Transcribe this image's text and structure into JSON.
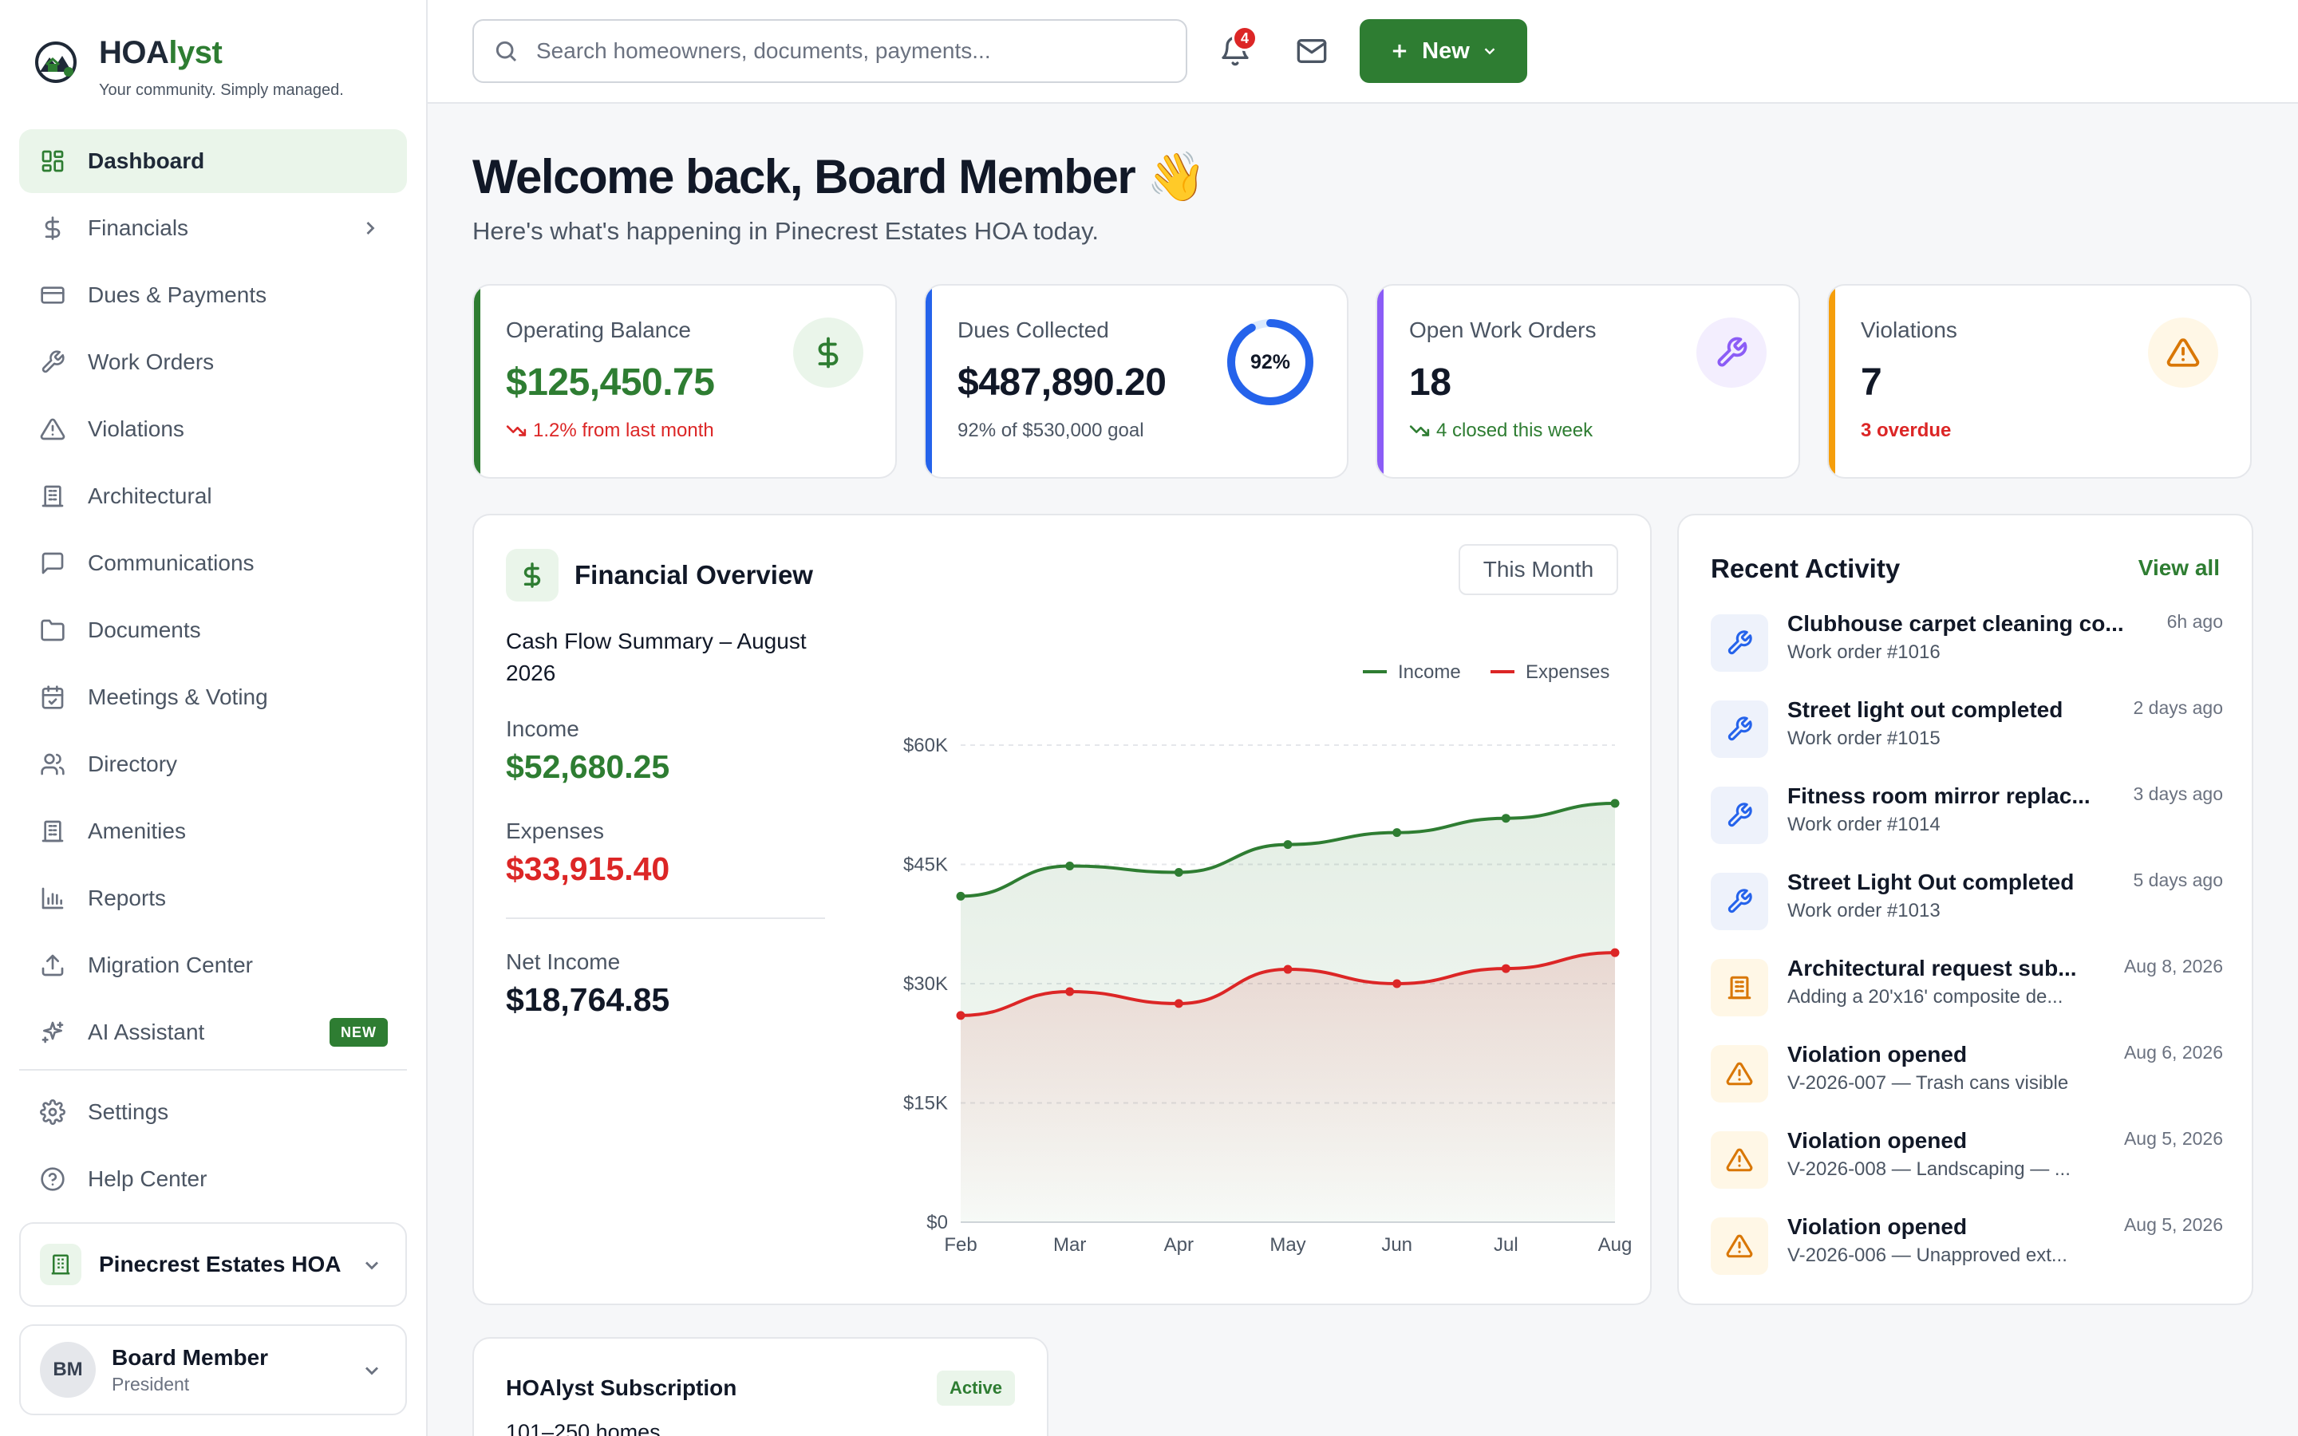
{
  "brand": {
    "name_part1": "HOA",
    "name_part2": "lyst",
    "tagline": "Your community. Simply managed."
  },
  "sidebar": {
    "items": [
      {
        "label": "Dashboard",
        "icon": "grid-icon",
        "active": true
      },
      {
        "label": "Financials",
        "icon": "dollar-icon"
      },
      {
        "label": "Dues & Payments",
        "icon": "credit-card-icon"
      },
      {
        "label": "Work Orders",
        "icon": "wrench-icon"
      },
      {
        "label": "Violations",
        "icon": "warning-icon"
      },
      {
        "label": "Architectural",
        "icon": "building-icon"
      },
      {
        "label": "Communications",
        "icon": "chat-icon"
      },
      {
        "label": "Documents",
        "icon": "folder-icon"
      },
      {
        "label": "Meetings & Voting",
        "icon": "calendar-check-icon"
      },
      {
        "label": "Directory",
        "icon": "users-icon"
      },
      {
        "label": "Amenities",
        "icon": "building-icon"
      },
      {
        "label": "Reports",
        "icon": "bar-chart-icon"
      },
      {
        "label": "Migration Center",
        "icon": "upload-icon"
      },
      {
        "label": "AI Assistant",
        "icon": "sparkles-icon",
        "badge": "NEW"
      },
      {
        "label": "Settings",
        "icon": "gear-icon"
      },
      {
        "label": "Help Center",
        "icon": "help-circle-icon"
      }
    ],
    "org_name": "Pinecrest Estates HOA",
    "user": {
      "initials": "BM",
      "name": "Board Member",
      "role": "President"
    }
  },
  "topbar": {
    "search_placeholder": "Search homeowners, documents, payments...",
    "notification_count": "4",
    "new_label": "New"
  },
  "main": {
    "welcome": "Welcome back, Board Member 👋",
    "subtitle": "Here's what's happening in Pinecrest Estates HOA today."
  },
  "stats": [
    {
      "label": "Operating Balance",
      "value": "$125,450.75",
      "sub": "1.2% from last month",
      "accent": "#2e7d32",
      "sub_color": "#dc2626"
    },
    {
      "label": "Dues Collected",
      "value": "$487,890.20",
      "sub": "92% of $530,000 goal",
      "accent": "#2563eb",
      "progress": 0.92,
      "progress_label": "92%"
    },
    {
      "label": "Open Work Orders",
      "value": "18",
      "sub": "4 closed this week",
      "accent": "#8b5cf6",
      "sub_color": "#2e7d32"
    },
    {
      "label": "Violations",
      "value": "7",
      "sub": "3 overdue",
      "accent": "#f59e0b",
      "sub_color": "#dc2626"
    }
  ],
  "financial": {
    "title": "Financial Overview",
    "period_button": "This Month",
    "summary_title": "Cash Flow Summary – August 2026",
    "income_label": "Income",
    "income_value": "$52,680.25",
    "expenses_label": "Expenses",
    "expenses_value": "$33,915.40",
    "net_label": "Net Income",
    "net_value": "$18,764.85"
  },
  "chart_data": {
    "type": "line",
    "categories": [
      "Feb",
      "Mar",
      "Apr",
      "May",
      "Jun",
      "Jul",
      "Aug"
    ],
    "series": [
      {
        "name": "Income",
        "color": "#2e7d32",
        "values": [
          41000,
          44800,
          44000,
          47500,
          49000,
          50800,
          52680
        ]
      },
      {
        "name": "Expenses",
        "color": "#dc2626",
        "values": [
          26000,
          29000,
          27500,
          31800,
          30000,
          31900,
          33900
        ]
      }
    ],
    "ylim": [
      0,
      60000
    ],
    "yticks": [
      0,
      15000,
      30000,
      45000,
      60000
    ],
    "ytick_labels": [
      "$0",
      "$15K",
      "$30K",
      "$45K",
      "$60K"
    ],
    "legend": "top-right",
    "grid": true
  },
  "activity": {
    "title": "Recent Activity",
    "view_all": "View all",
    "items": [
      {
        "title": "Clubhouse carpet cleaning co...",
        "sub": "Work order #1016",
        "time": "6h ago",
        "icon": "wrench-icon",
        "kind": "work"
      },
      {
        "title": "Street light out completed",
        "sub": "Work order #1015",
        "time": "2 days ago",
        "icon": "wrench-icon",
        "kind": "work"
      },
      {
        "title": "Fitness room mirror replac...",
        "sub": "Work order #1014",
        "time": "3 days ago",
        "icon": "wrench-icon",
        "kind": "work"
      },
      {
        "title": "Street Light Out completed",
        "sub": "Work order #1013",
        "time": "5 days ago",
        "icon": "wrench-icon",
        "kind": "work"
      },
      {
        "title": "Architectural request sub...",
        "sub": "Adding a 20'x16' composite de...",
        "time": "Aug 8, 2026",
        "icon": "building-icon",
        "kind": "arch"
      },
      {
        "title": "Violation opened",
        "sub": "V-2026-007 — Trash cans visible",
        "time": "Aug 6, 2026",
        "icon": "warning-icon",
        "kind": "violation"
      },
      {
        "title": "Violation opened",
        "sub": "V-2026-008 — Landscaping — ...",
        "time": "Aug 5, 2026",
        "icon": "warning-icon",
        "kind": "violation"
      },
      {
        "title": "Violation opened",
        "sub": "V-2026-006 — Unapproved ext...",
        "time": "Aug 5, 2026",
        "icon": "warning-icon",
        "kind": "violation"
      }
    ]
  },
  "subscription": {
    "title": "HOAlyst Subscription",
    "status": "Active",
    "detail": "101–250 homes"
  }
}
